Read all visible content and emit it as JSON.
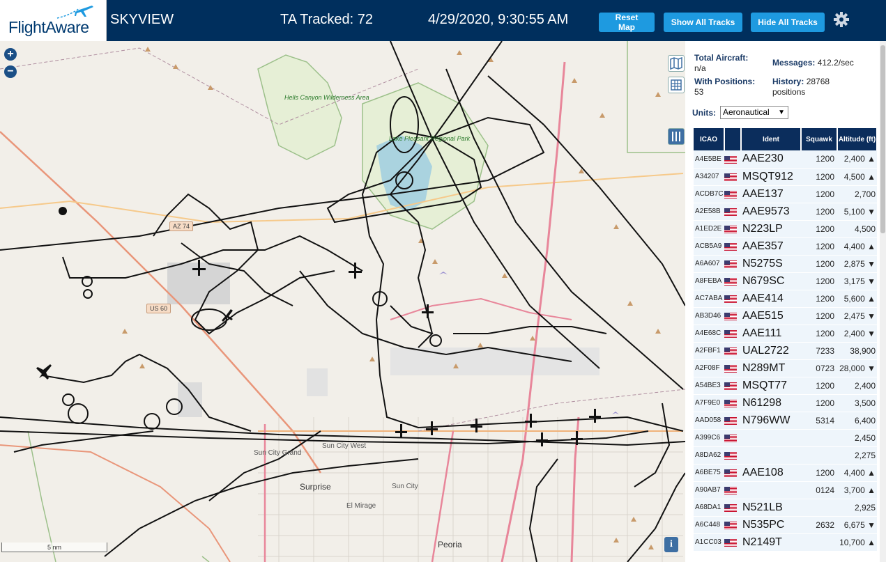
{
  "header": {
    "logo_text": "FlightAware",
    "app_title": "SKYVIEW",
    "ta_tracked": "TA Tracked: 72",
    "datetime": "4/29/2020, 9:30:55 AM",
    "buttons": {
      "reset_map": "Reset Map",
      "show_all_tracks": "Show All Tracks",
      "hide_all_tracks": "Hide All Tracks"
    },
    "settings_icon": "gear-icon"
  },
  "map": {
    "zoom_in": "+",
    "zoom_out": "−",
    "scale_label": "5 nm",
    "info_label": "i",
    "labels": {
      "hells_canyon": "Hells Canyon Wilderness Area",
      "lake_pleasant": "Lake Pleasant Regional Park",
      "sun_city_grand": "Sun City Grand",
      "sun_city_west": "Sun City West",
      "surprise": "Surprise",
      "sun_city": "Sun City",
      "el_mirage": "El Mirage",
      "peoria": "Peoria"
    },
    "shields": {
      "az74": "AZ 74",
      "us60": "US 60"
    },
    "tools": [
      "map-layers-icon",
      "grid-icon",
      "columns-icon"
    ]
  },
  "panel": {
    "total_aircraft_label": "Total Aircraft:",
    "total_aircraft_value": "n/a",
    "with_positions_label": "With Positions:",
    "with_positions_value": "53",
    "messages_label": "Messages:",
    "messages_value": "412.2/sec",
    "history_label": "History:",
    "history_value": "28768 positions",
    "units_label": "Units:",
    "units_value": "Aeronautical",
    "columns": [
      "ICAO",
      "",
      "Ident",
      "Squawk",
      "Altitude (ft)"
    ],
    "rows": [
      {
        "icao": "A4E5BE",
        "ident": "AAE230",
        "squawk": "1200",
        "alt": "2,400 ▲"
      },
      {
        "icao": "A34207",
        "ident": "MSQT912",
        "squawk": "1200",
        "alt": "4,500 ▲"
      },
      {
        "icao": "ACDB7C",
        "ident": "AAE137",
        "squawk": "1200",
        "alt": "2,700"
      },
      {
        "icao": "A2E58B",
        "ident": "AAE9573",
        "squawk": "1200",
        "alt": "5,100 ▼"
      },
      {
        "icao": "A1ED2E",
        "ident": "N223LP",
        "squawk": "1200",
        "alt": "4,500"
      },
      {
        "icao": "ACB5A9",
        "ident": "AAE357",
        "squawk": "1200",
        "alt": "4,400 ▲"
      },
      {
        "icao": "A6A607",
        "ident": "N5275S",
        "squawk": "1200",
        "alt": "2,875 ▼"
      },
      {
        "icao": "A8FEBA",
        "ident": "N679SC",
        "squawk": "1200",
        "alt": "3,175 ▼"
      },
      {
        "icao": "AC7ABA",
        "ident": "AAE414",
        "squawk": "1200",
        "alt": "5,600 ▲"
      },
      {
        "icao": "AB3D46",
        "ident": "AAE515",
        "squawk": "1200",
        "alt": "2,475 ▼"
      },
      {
        "icao": "A4E68C",
        "ident": "AAE111",
        "squawk": "1200",
        "alt": "2,400 ▼"
      },
      {
        "icao": "A2FBF1",
        "ident": "UAL2722",
        "squawk": "7233",
        "alt": "38,900"
      },
      {
        "icao": "A2F08F",
        "ident": "N289MT",
        "squawk": "0723",
        "alt": "28,000 ▼"
      },
      {
        "icao": "A54BE3",
        "ident": "MSQT77",
        "squawk": "1200",
        "alt": "2,400"
      },
      {
        "icao": "A7F9E0",
        "ident": "N61298",
        "squawk": "1200",
        "alt": "3,500"
      },
      {
        "icao": "AAD058",
        "ident": "N796WW",
        "squawk": "5314",
        "alt": "6,400"
      },
      {
        "icao": "A399C6",
        "ident": "",
        "squawk": "",
        "alt": "2,450"
      },
      {
        "icao": "A8DA62",
        "ident": "",
        "squawk": "",
        "alt": "2,275"
      },
      {
        "icao": "A6BE75",
        "ident": "AAE108",
        "squawk": "1200",
        "alt": "4,400 ▲"
      },
      {
        "icao": "A90AB7",
        "ident": "",
        "squawk": "0124",
        "alt": "3,700 ▲"
      },
      {
        "icao": "A68DA1",
        "ident": "N521LB",
        "squawk": "",
        "alt": "2,925"
      },
      {
        "icao": "A6C448",
        "ident": "N535PC",
        "squawk": "2632",
        "alt": "6,675 ▼"
      },
      {
        "icao": "A1CC03",
        "ident": "N2149T",
        "squawk": "",
        "alt": "10,700 ▲"
      }
    ]
  }
}
